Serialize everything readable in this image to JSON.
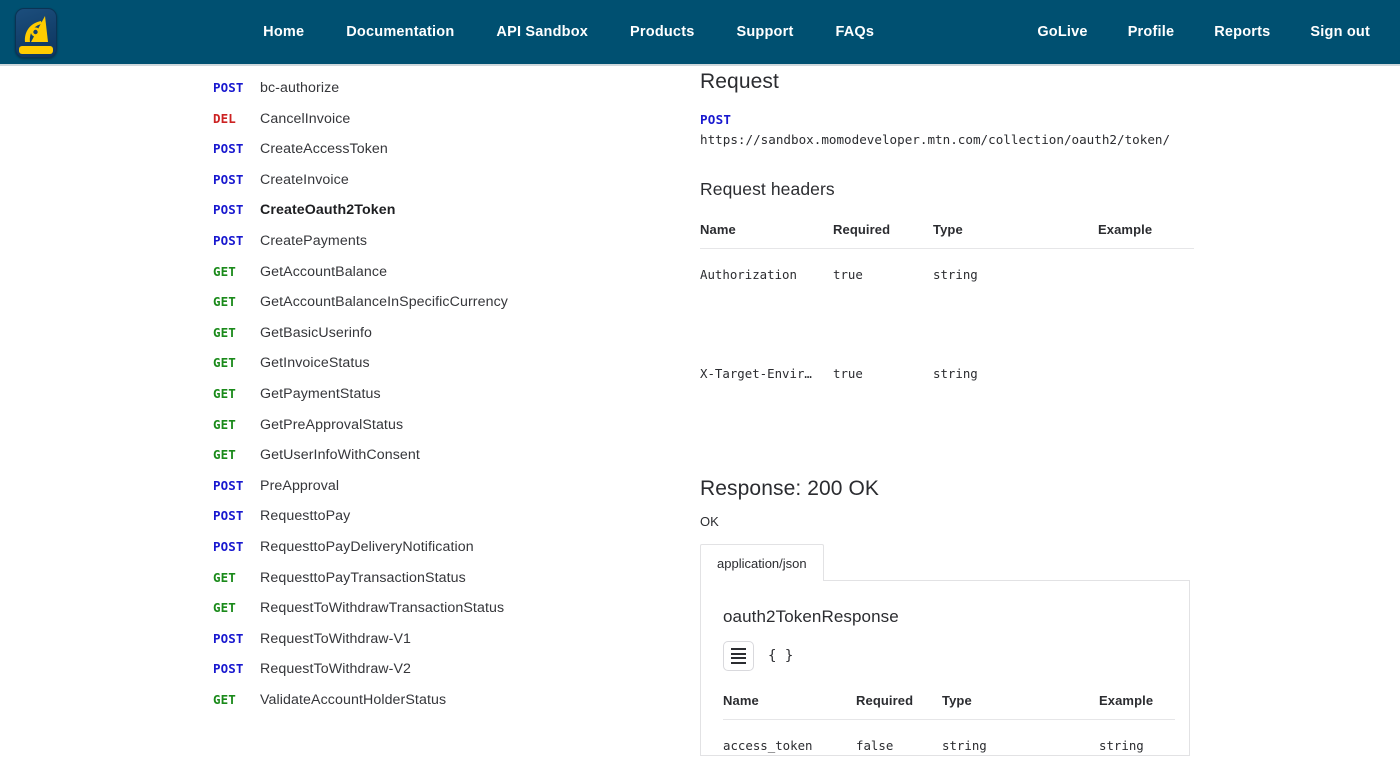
{
  "brand": {
    "logo_name": "mtn-momo-developer-logo",
    "header_bg": "#005071",
    "logo_accent": "#ffcc00"
  },
  "nav": {
    "center_links": [
      {
        "label": "Home",
        "name": "nav-home"
      },
      {
        "label": "Documentation",
        "name": "nav-documentation"
      },
      {
        "label": "API Sandbox",
        "name": "nav-api-sandbox"
      },
      {
        "label": "Products",
        "name": "nav-products"
      },
      {
        "label": "Support",
        "name": "nav-support"
      },
      {
        "label": "FAQs",
        "name": "nav-faqs"
      }
    ],
    "right_links": [
      {
        "label": "GoLive",
        "name": "nav-golive"
      },
      {
        "label": "Profile",
        "name": "nav-profile"
      },
      {
        "label": "Reports",
        "name": "nav-reports"
      },
      {
        "label": "Sign out",
        "name": "nav-sign-out"
      }
    ]
  },
  "endpoints": [
    {
      "verb": "POST",
      "name": "bc-authorize",
      "active": false
    },
    {
      "verb": "DEL",
      "name": "CancelInvoice",
      "active": false
    },
    {
      "verb": "POST",
      "name": "CreateAccessToken",
      "active": false
    },
    {
      "verb": "POST",
      "name": "CreateInvoice",
      "active": false
    },
    {
      "verb": "POST",
      "name": "CreateOauth2Token",
      "active": true
    },
    {
      "verb": "POST",
      "name": "CreatePayments",
      "active": false
    },
    {
      "verb": "GET",
      "name": "GetAccountBalance",
      "active": false
    },
    {
      "verb": "GET",
      "name": "GetAccountBalanceInSpecificCurrency",
      "active": false
    },
    {
      "verb": "GET",
      "name": "GetBasicUserinfo",
      "active": false
    },
    {
      "verb": "GET",
      "name": "GetInvoiceStatus",
      "active": false
    },
    {
      "verb": "GET",
      "name": "GetPaymentStatus",
      "active": false
    },
    {
      "verb": "GET",
      "name": "GetPreApprovalStatus",
      "active": false
    },
    {
      "verb": "GET",
      "name": "GetUserInfoWithConsent",
      "active": false
    },
    {
      "verb": "POST",
      "name": "PreApproval",
      "active": false
    },
    {
      "verb": "POST",
      "name": "RequesttoPay",
      "active": false
    },
    {
      "verb": "POST",
      "name": "RequesttoPayDeliveryNotification",
      "active": false
    },
    {
      "verb": "GET",
      "name": "RequesttoPayTransactionStatus",
      "active": false
    },
    {
      "verb": "GET",
      "name": "RequestToWithdrawTransactionStatus",
      "active": false
    },
    {
      "verb": "POST",
      "name": "RequestToWithdraw-V1",
      "active": false
    },
    {
      "verb": "POST",
      "name": "RequestToWithdraw-V2",
      "active": false
    },
    {
      "verb": "GET",
      "name": "ValidateAccountHolderStatus",
      "active": false
    }
  ],
  "request": {
    "heading": "Request",
    "method": "POST",
    "url": "https://sandbox.momodeveloper.mtn.com/collection/oauth2/token/",
    "headers_heading": "Request headers",
    "columns": [
      "Name",
      "Required",
      "Type",
      "Example"
    ],
    "rows": [
      {
        "name": "Authorization",
        "required": "true",
        "type": "string",
        "example": ""
      },
      {
        "name": "X-Target-Envir…",
        "required": "true",
        "type": "string",
        "example": ""
      }
    ]
  },
  "response": {
    "heading": "Response: 200 OK",
    "status_text": "OK",
    "tab_label": "application/json",
    "schema_title": "oauth2TokenResponse",
    "view_toggle_label": "{ }",
    "columns": [
      "Name",
      "Required",
      "Type",
      "Example"
    ],
    "rows": [
      {
        "name": "access_token",
        "required": "false",
        "type": "string",
        "example": "string"
      }
    ]
  }
}
